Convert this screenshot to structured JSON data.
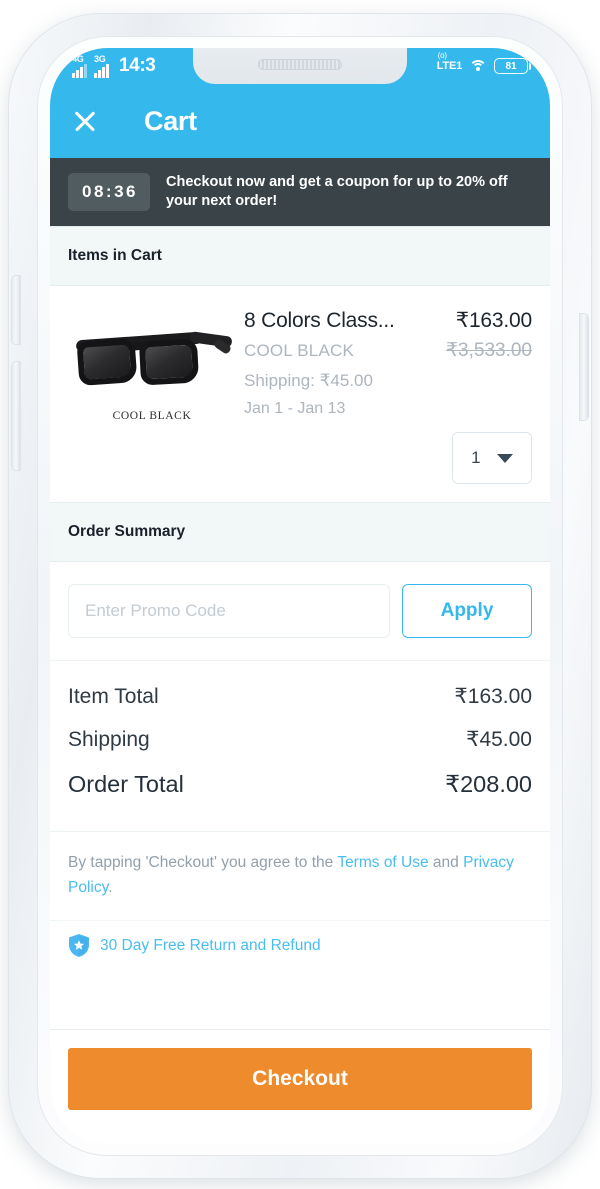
{
  "status_bar": {
    "network_1": "4G",
    "network_2": "3G",
    "time": "14:3",
    "carrier": "LTE1",
    "carrier_sup": "(o)",
    "battery": "81"
  },
  "app_bar": {
    "close_icon": "close-icon",
    "title": "Cart"
  },
  "promo_banner": {
    "timer": "08:36",
    "message": "Checkout now and get a coupon for up to 20% off your next order!"
  },
  "items_section": {
    "heading": "Items in Cart",
    "product": {
      "image_caption": "COOL BLACK",
      "title": "8 Colors Class...",
      "price": "₹163.00",
      "variant": "COOL BLACK",
      "original_price": "₹3,533.00",
      "shipping": "Shipping: ₹45.00",
      "delivery_window": "Jan 1 - Jan 13",
      "quantity": "1"
    }
  },
  "order_summary": {
    "heading": "Order Summary",
    "promo_placeholder": "Enter Promo Code",
    "promo_value": "",
    "apply_label": "Apply",
    "lines": [
      {
        "label": "Item Total",
        "value": "₹163.00"
      },
      {
        "label": "Shipping",
        "value": "₹45.00"
      },
      {
        "label": "Order Total",
        "value": "₹208.00"
      }
    ]
  },
  "terms": {
    "prefix": "By tapping 'Checkout' you agree to the ",
    "link_terms": "Terms of Use",
    "conjunction": " and ",
    "link_privacy": "Privacy Policy",
    "suffix": "."
  },
  "guarantee": {
    "icon": "shield-icon",
    "text": "30 Day Free Return and Refund"
  },
  "footer": {
    "checkout_label": "Checkout"
  },
  "colors": {
    "accent_blue": "#35b9ec",
    "banner_dark": "#3a4448",
    "checkout_orange": "#ed8b2d",
    "link_blue": "#49bdf0",
    "muted_gray": "#adb5bd"
  }
}
